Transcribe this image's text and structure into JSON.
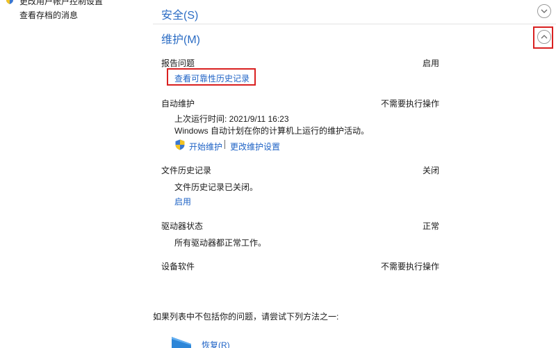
{
  "sidebar": {
    "partial_text": "更改用户帐户控制设置",
    "archived_messages_link": "查看存档的消息"
  },
  "sections": {
    "security": {
      "title": "安全(S)"
    },
    "maintenance": {
      "title": "维护(M)"
    }
  },
  "maintenance": {
    "report_problems": {
      "label": "报告问题",
      "status": "启用",
      "link": "查看可靠性历史记录"
    },
    "auto_maintenance": {
      "label": "自动维护",
      "status": "不需要执行操作",
      "last_run": "上次运行时间: 2021/9/11 16:23",
      "description": "Windows 自动计划在你的计算机上运行的维护活动。",
      "start_link": "开始维护",
      "change_settings_link": "更改维护设置"
    },
    "file_history": {
      "label": "文件历史记录",
      "status": "关闭",
      "description": "文件历史记录已关闭。",
      "enable_link": "启用"
    },
    "drive_status": {
      "label": "驱动器状态",
      "status": "正常",
      "description": "所有驱动器都正常工作。"
    },
    "device_software": {
      "label": "设备软件",
      "status": "不需要执行操作"
    }
  },
  "footer": {
    "hint": "如果列表中不包括你的问题，请尝试下列方法之一:",
    "restore_link": "恢复(R)"
  },
  "colors": {
    "link": "#1f63c6",
    "section_title": "#2b6cc4",
    "highlight": "#d92020"
  }
}
